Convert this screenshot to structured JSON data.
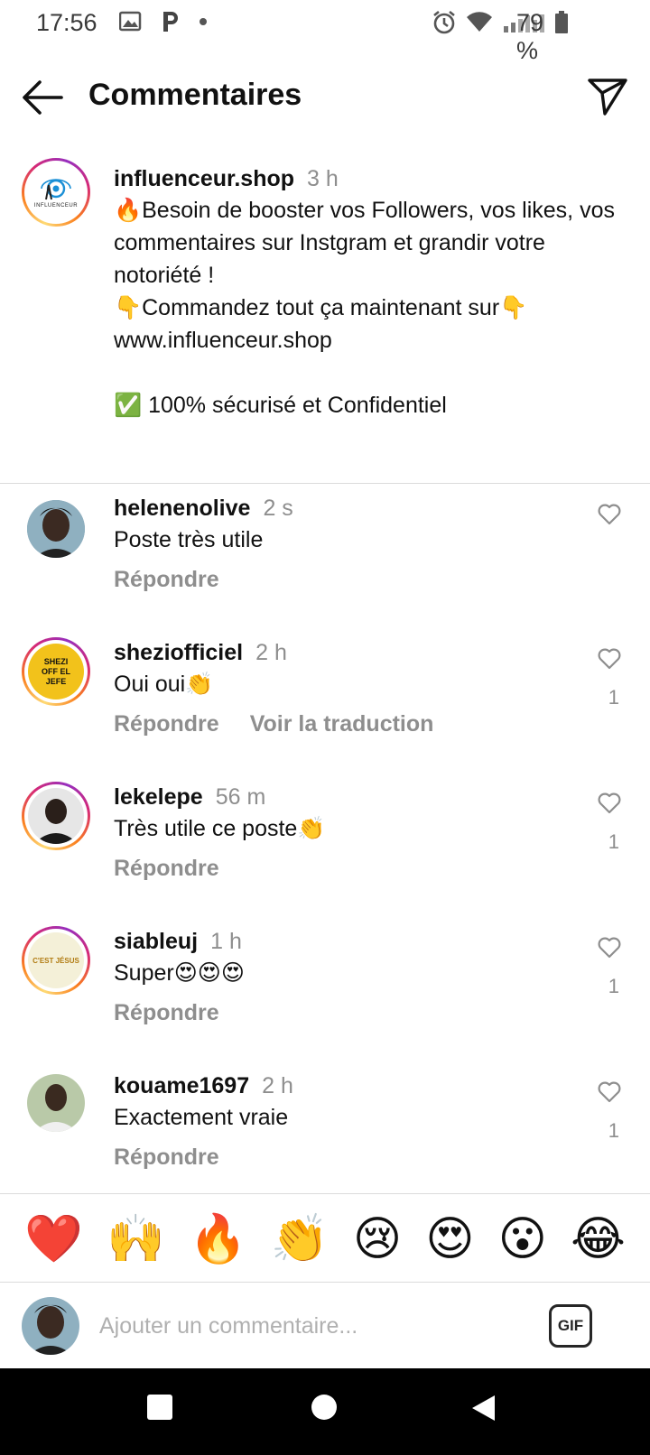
{
  "status_bar": {
    "time": "17:56",
    "battery": "79 %"
  },
  "header": {
    "title": "Commentaires"
  },
  "caption": {
    "username": "influenceur.shop",
    "time": "3 h",
    "text": "🔥Besoin de booster vos Followers, vos likes, vos commentaires sur Instgram et grandir votre notoriété !\n👇Commandez tout ça maintenant sur👇\n www.influenceur.shop\n\n✅ 100% sécurisé et Confidentiel",
    "avatar_label": "INFLUENCEUR"
  },
  "comments": [
    {
      "username": "helenenolive",
      "time": "2 s",
      "text": "Poste très utile",
      "reply": "Répondre",
      "likes": ""
    },
    {
      "username": "sheziofficiel",
      "time": "2 h",
      "text": "Oui oui👏",
      "reply": "Répondre",
      "translate": "Voir la traduction",
      "likes": "1",
      "avatar_label": "SHEZI OFF EL JEFE"
    },
    {
      "username": "lekelepe",
      "time": "56 m",
      "text": "Très utile ce poste👏",
      "reply": "Répondre",
      "likes": "1"
    },
    {
      "username": "siableuj",
      "time": "1 h",
      "text": "Super😍😍😍",
      "reply": "Répondre",
      "likes": "1",
      "avatar_label": "C'EST JÉSUS"
    },
    {
      "username": "kouame1697",
      "time": "2 h",
      "text": "Exactement vraie",
      "reply": "Répondre",
      "likes": "1"
    }
  ],
  "emoji_bar": [
    "❤️",
    "🙌",
    "🔥",
    "👏",
    "😢",
    "😍",
    "😮",
    "😂"
  ],
  "input": {
    "placeholder": "Ajouter un commentaire...",
    "gif_label": "GIF"
  },
  "colors": {
    "muted": "#8e8e8e",
    "divider": "#dbdbdb",
    "text": "#111111"
  }
}
